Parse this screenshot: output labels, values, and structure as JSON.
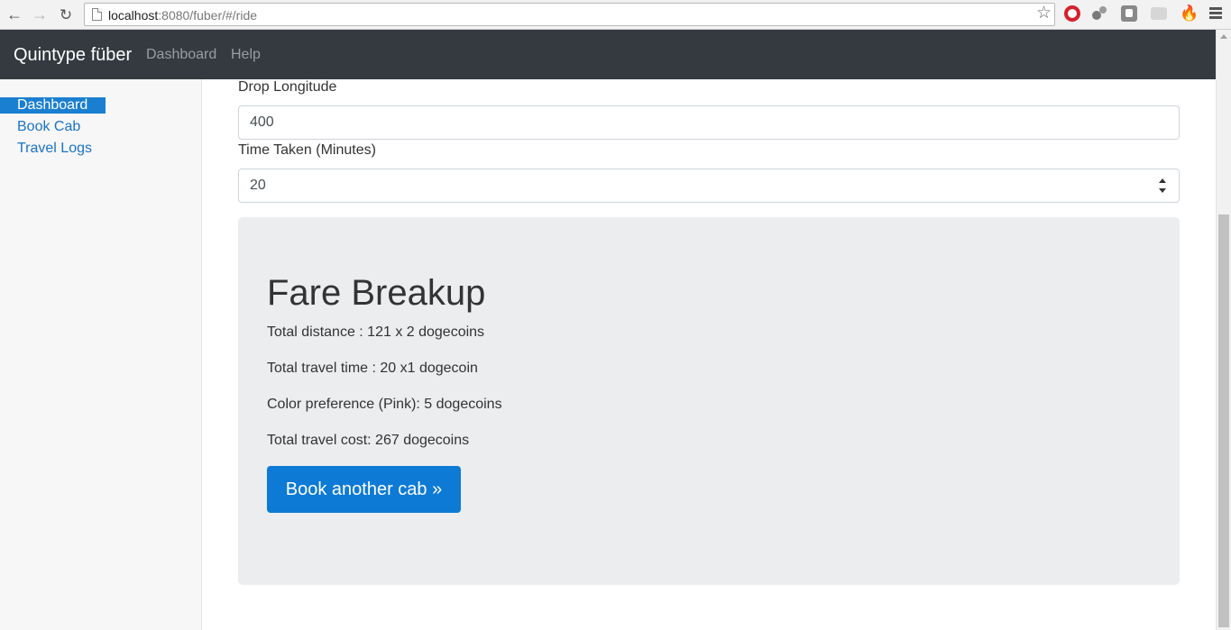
{
  "browser": {
    "url_host": "localhost",
    "url_rest": ":8080/fuber/#/ride",
    "icons": [
      "back-icon",
      "forward-icon",
      "reload-icon",
      "page-icon",
      "star-icon",
      "opera-icon",
      "extension-icon",
      "extension-icon",
      "extension-icon",
      "fire-icon",
      "menu-icon"
    ]
  },
  "navbar": {
    "brand": "Quintype füber",
    "links": [
      "Dashboard",
      "Help"
    ]
  },
  "sidebar": {
    "items": [
      {
        "label": "Dashboard",
        "active": true
      },
      {
        "label": "Book Cab",
        "active": false
      },
      {
        "label": "Travel Logs",
        "active": false
      }
    ]
  },
  "form": {
    "drop_longitude_label": "Drop Longitude",
    "drop_longitude_value": "400",
    "time_taken_label": "Time Taken (Minutes)",
    "time_taken_value": "20"
  },
  "fare": {
    "title": "Fare Breakup",
    "lines": [
      "Total distance : 121 x 2 dogecoins",
      "Total travel time : 20 x1 dogecoin",
      "Color preference (Pink): 5 dogecoins",
      "Total travel cost: 267 dogecoins"
    ],
    "button_label": "Book another cab »"
  },
  "colors": {
    "navbar_bg": "#343a40",
    "primary": "#0d7ad6",
    "active_sidebar": "#1a7fd1",
    "jumbotron_bg": "#ebedef"
  }
}
